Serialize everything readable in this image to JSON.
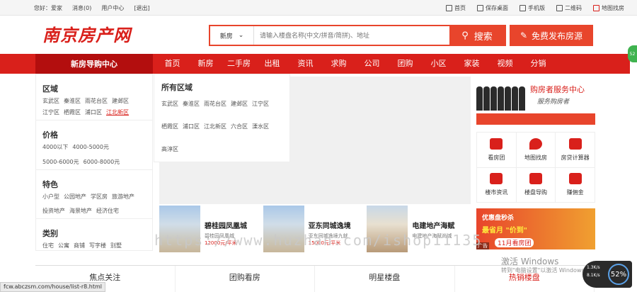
{
  "topbar": {
    "left": [
      "您好：爱家",
      "消息(0)",
      "用户中心",
      "[退出]"
    ],
    "right": [
      "首页",
      "保存桌面",
      "手机版",
      "二维码",
      "地图找房"
    ]
  },
  "logo": "南京房产网",
  "search": {
    "type": "新房",
    "placeholder": "请输入楼盘名称(中文/拼音/简拼)、地址",
    "button": "搜索"
  },
  "publish": "免费发布房源",
  "nav": {
    "guide": "新房导购中心",
    "items": [
      "首页",
      "新房",
      "二手房",
      "出租",
      "资讯",
      "求购",
      "公司",
      "团购",
      "小区",
      "家装",
      "视频",
      "分销"
    ]
  },
  "sidebar": {
    "region_title": "区域",
    "region_row1": [
      "玄武区",
      "秦淮区",
      "雨花台区",
      "建邺区"
    ],
    "region_row2": [
      "江宁区",
      "栖霞区",
      "浦口区",
      "江北新区"
    ],
    "price_title": "价格",
    "price_row1": [
      "4000以下",
      "4000-5000元"
    ],
    "price_row2": [
      "5000-6000元",
      "6000-8000元"
    ],
    "feature_title": "特色",
    "feature_row1": [
      "小户型",
      "公园地产",
      "学区房",
      "旅游地产"
    ],
    "feature_row2": [
      "投资地产",
      "海景地产",
      "经济住宅"
    ],
    "type_title": "类别",
    "type_row": [
      "住宅",
      "公寓",
      "商铺",
      "写字楼",
      "别墅"
    ]
  },
  "flyout": {
    "title": "所有区域",
    "items": [
      "玄武区",
      "秦淮区",
      "雨花台区",
      "建邺区",
      "江宁区",
      "栖霞区",
      "浦口区",
      "江北新区",
      "六合区",
      "溧水区",
      "高淳区"
    ]
  },
  "service": {
    "title": "购房者服务中心",
    "subtitle": "服务购房者"
  },
  "grid": [
    "看房团",
    "地图找房",
    "房贷计算器",
    "楼市资讯",
    "楼盘导购",
    "赚佣金"
  ],
  "properties": [
    {
      "name": "碧桂园凤凰城",
      "sub": "碧桂园凤凰城",
      "price": "12000元/平米"
    },
    {
      "name": "亚东同城逸境",
      "sub": "亚东同城逸境九就",
      "price": "15000元/平米"
    },
    {
      "name": "电建地产海赋",
      "sub": "电建地产海赋尚城",
      "price": ""
    }
  ],
  "ad": {
    "line1": "优惠盘秒杀",
    "line2": "最省月 \"价到\"",
    "line3": "11月看房团",
    "tag": "广告"
  },
  "tabs": [
    "焦点关注",
    "团购看房",
    "明星楼盘",
    "热销楼盘"
  ],
  "watermark": "https://www.huzhan.com/ishop11135",
  "status_url": "fcw.abczsm.com/house/list-r8.html",
  "windows": {
    "line1": "激活 Windows",
    "line2": "转到\"电脑设置\"以激活 Windows。"
  },
  "net": {
    "up": "1.3K/s",
    "down": "8.1K/s",
    "percent": "52%"
  },
  "side_badge": "52",
  "colors": {
    "brand": "#d9201b",
    "accent": "#e8452c",
    "nav_dark": "#b30e0e"
  }
}
